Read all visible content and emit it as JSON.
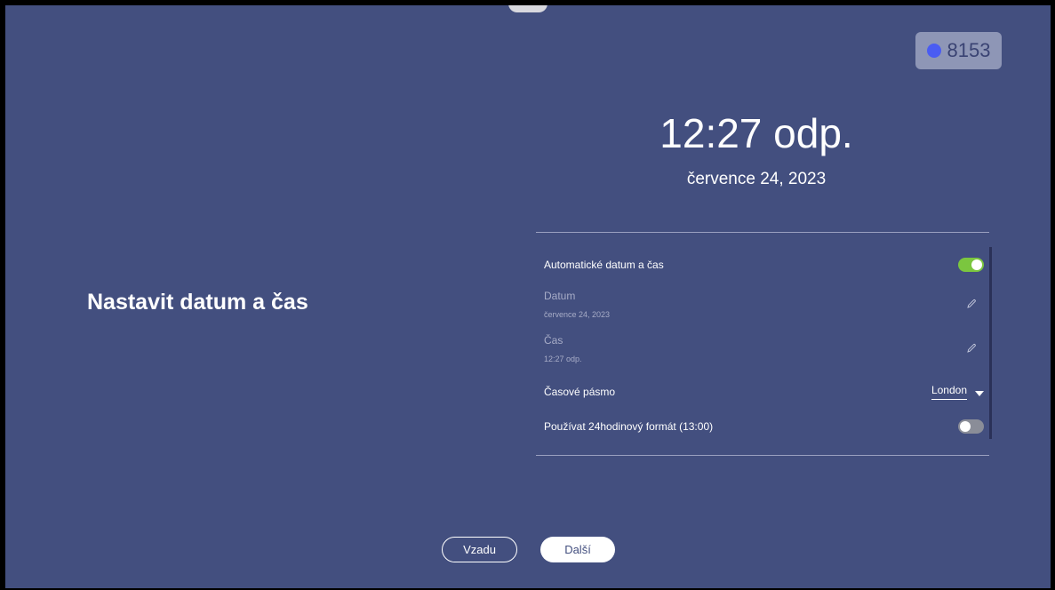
{
  "header": {
    "badge_number": "8153",
    "time_display": "12:27 odp.",
    "date_display": "července 24, 2023"
  },
  "page": {
    "title": "Nastavit datum a čas"
  },
  "settings": {
    "auto_datetime": {
      "label": "Automatické datum a čas",
      "enabled": true
    },
    "date": {
      "label": "Datum",
      "value": "července 24, 2023"
    },
    "time": {
      "label": "Čas",
      "value": "12:27 odp."
    },
    "timezone": {
      "label": "Časové pásmo",
      "value": "London"
    },
    "format24": {
      "label": "Používat 24hodinový formát (13:00)",
      "enabled": false
    }
  },
  "footer": {
    "back_label": "Vzadu",
    "next_label": "Další"
  },
  "colors": {
    "background": "#434f7f",
    "toggle_on": "#7bc63f",
    "badge_dot": "#4a5cf2"
  },
  "icons": {
    "edit": "pencil-icon",
    "dropdown": "caret-down-icon"
  }
}
